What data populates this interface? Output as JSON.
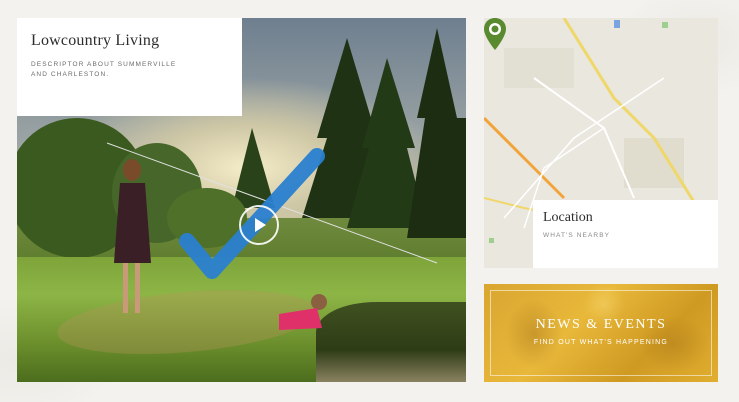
{
  "hero": {
    "title": "Lowcountry Living",
    "descriptor": "DESCRIPTOR ABOUT SUMMERVILLE AND CHARLESTON.",
    "play_icon": "play-icon",
    "check_icon": "checkmark-icon"
  },
  "location": {
    "title": "Location",
    "subtitle": "WHAT'S NEARBY",
    "pin_icon": "map-pin-icon"
  },
  "news": {
    "title": "NEWS & EVENTS",
    "subtitle": "FIND OUT WHAT'S HAPPENING"
  },
  "colors": {
    "background": "#f3f2ee",
    "card": "#ffffff",
    "news_gold": "#e0ae30",
    "check_blue": "#2a7fd0",
    "pin_green": "#5a8a2f"
  }
}
